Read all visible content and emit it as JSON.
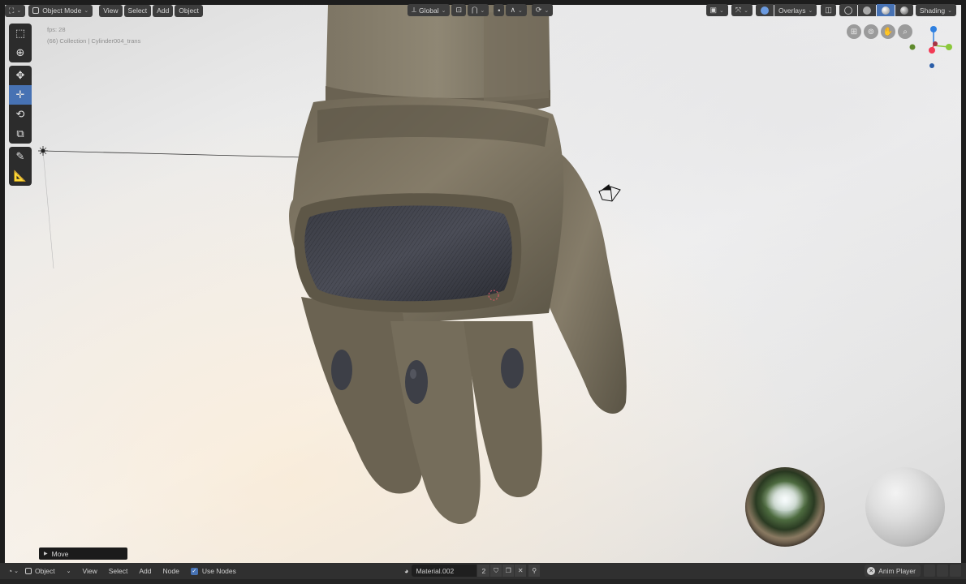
{
  "header": {
    "mode": "Object Mode",
    "menus": [
      "View",
      "Select",
      "Add",
      "Object"
    ],
    "transform_orientation": "Global",
    "overlays_label": "Overlays",
    "shading_label": "Shading"
  },
  "viewport_info": {
    "fps": "fps: 28",
    "collection": "(66) Collection | Cylinder004_trans"
  },
  "toolbar": {
    "tools": [
      "select-box",
      "cursor",
      "move",
      "transform",
      "rotate",
      "scale",
      "annotate",
      "measure"
    ],
    "active": "transform"
  },
  "gizmo": {
    "axis_colors": {
      "x": "#f23a55",
      "y": "#8ac83a",
      "z": "#2f80e0"
    }
  },
  "operator_panel": {
    "label": "Move"
  },
  "bottom_bar": {
    "editor_mode": "Object",
    "menus": [
      "View",
      "Select",
      "Add",
      "Node"
    ],
    "use_nodes_label": "Use Nodes",
    "material_name": "Material.002",
    "material_users": "2",
    "anim_player_label": "Anim Player"
  },
  "colors": {
    "accent": "#4772b3",
    "header_button": "#3d3d3d",
    "bottom_bar": "#303030"
  }
}
